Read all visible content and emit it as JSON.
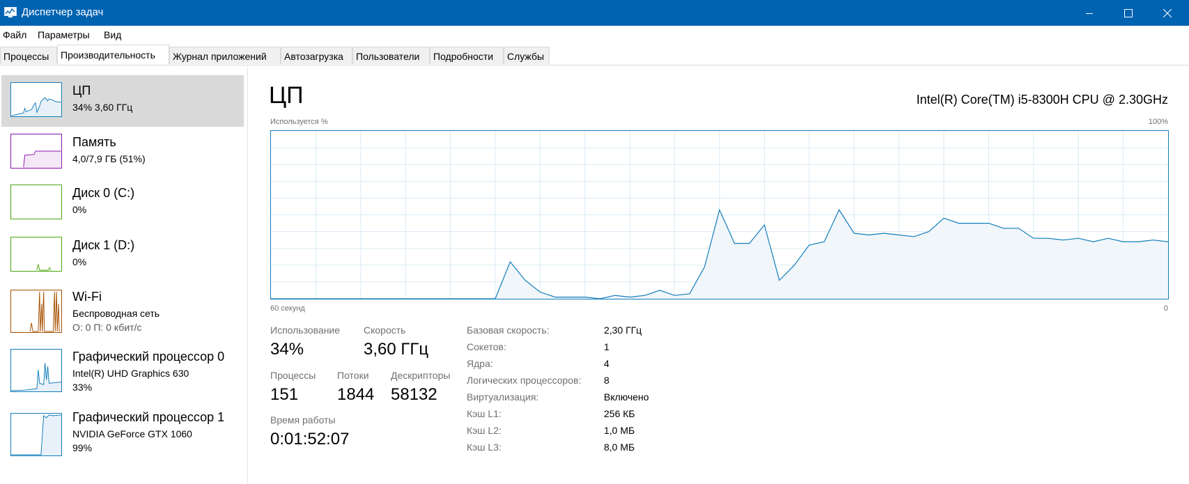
{
  "window": {
    "title": "Диспетчер задач"
  },
  "menu": [
    "Файл",
    "Параметры",
    "Вид"
  ],
  "tabs": [
    "Процессы",
    "Производительность",
    "Журнал приложений",
    "Автозагрузка",
    "Пользователи",
    "Подробности",
    "Службы"
  ],
  "active_tab": "Производительность",
  "sidebar": {
    "items": [
      {
        "title": "ЦП",
        "sub1": "34%  3,60 ГГц",
        "color": "#117dbb",
        "icon": "cpu-graph"
      },
      {
        "title": "Память",
        "sub1": "4,0/7,9 ГБ (51%)",
        "color": "#8b12ae",
        "icon": "memory-graph"
      },
      {
        "title": "Диск 0 (C:)",
        "sub1": "0%",
        "color": "#4da60c",
        "icon": "disk-graph"
      },
      {
        "title": "Диск 1 (D:)",
        "sub1": "0%",
        "color": "#4da60c",
        "icon": "disk-graph"
      },
      {
        "title": "Wi-Fi",
        "sub1": "Беспроводная сеть",
        "sub2": "О: 0 П: 0 кбит/с",
        "color": "#a74f01",
        "icon": "network-graph"
      },
      {
        "title": "Графический процессор 0",
        "sub1": "Intel(R) UHD Graphics 630",
        "sub2": "33%",
        "color": "#117dbb",
        "icon": "gpu-graph"
      },
      {
        "title": "Графический процессор 1",
        "sub1": "NVIDIA GeForce GTX 1060",
        "sub2": "99%",
        "color": "#117dbb",
        "icon": "gpu-graph"
      }
    ]
  },
  "main": {
    "title": "ЦП",
    "cpu_model": "Intel(R) Core(TM) i5-8300H CPU @ 2.30GHz",
    "graph": {
      "ylabel": "Используется %",
      "ymax_label": "100%",
      "xleft_label": "60 секунд",
      "xright_label": "0"
    },
    "stats": {
      "usage_label": "Использование",
      "usage": "34%",
      "speed_label": "Скорость",
      "speed": "3,60 ГГц",
      "processes_label": "Процессы",
      "processes": "151",
      "threads_label": "Потоки",
      "threads": "1844",
      "handles_label": "Дескрипторы",
      "handles": "58132",
      "uptime_label": "Время работы",
      "uptime": "0:01:52:07"
    },
    "details": [
      {
        "label": "Базовая скорость:",
        "value": "2,30 ГГц"
      },
      {
        "label": "Сокетов:",
        "value": "1"
      },
      {
        "label": "Ядра:",
        "value": "4"
      },
      {
        "label": "Логических процессоров:",
        "value": "8"
      },
      {
        "label": "Виртуализация:",
        "value": "Включено"
      },
      {
        "label": "Кэш L1:",
        "value": "256 КБ"
      },
      {
        "label": "Кэш L2:",
        "value": "1,0 МБ"
      },
      {
        "label": "Кэш L3:",
        "value": "8,0 МБ"
      }
    ]
  },
  "chart_data": {
    "type": "area",
    "ylim": [
      0,
      100
    ],
    "x": [
      -60,
      -59,
      -58,
      -57,
      -56,
      -55,
      -54,
      -53,
      -52,
      -51,
      -50,
      -49,
      -48,
      -47,
      -46,
      -45,
      -44,
      -43,
      -42,
      -41,
      -40,
      -39,
      -38,
      -37,
      -36,
      -35,
      -34,
      -33,
      -32,
      -31,
      -30,
      -29,
      -28,
      -27,
      -26,
      -25,
      -24,
      -23,
      -22,
      -21,
      -20,
      -19,
      -18,
      -17,
      -16,
      -15,
      -14,
      -13,
      -12,
      -11,
      -10,
      -9,
      -8,
      -7,
      -6,
      -5,
      -4,
      -3,
      -2,
      -1,
      0
    ],
    "series": [
      {
        "values": [
          0,
          0,
          0,
          0,
          0,
          0,
          0,
          0,
          0,
          0,
          0,
          0,
          0,
          0,
          0,
          0,
          22,
          11,
          4,
          1,
          1,
          1,
          0,
          2,
          1,
          2,
          5,
          2,
          3,
          19,
          53,
          33,
          33,
          44,
          11,
          20,
          32,
          34,
          53,
          39,
          38,
          39,
          38,
          37,
          40,
          48,
          45,
          45,
          45,
          42,
          42,
          36,
          36,
          35,
          36,
          34,
          36,
          34,
          34,
          35,
          34
        ]
      }
    ]
  },
  "colors": {
    "titlebar": "#0063b1",
    "cpu": "#117dbb",
    "memory": "#8b12ae",
    "disk": "#4da60c",
    "network": "#a74f01"
  }
}
